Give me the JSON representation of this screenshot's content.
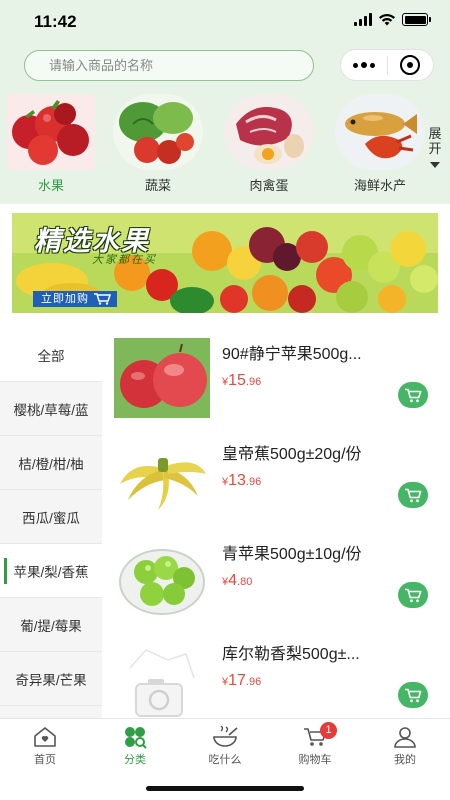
{
  "status_bar": {
    "time": "11:42"
  },
  "search": {
    "placeholder": "请输入商品的名称"
  },
  "categories": [
    {
      "label": "水果",
      "icon": "fruit-image"
    },
    {
      "label": "蔬菜",
      "icon": "vegetable-image"
    },
    {
      "label": "肉禽蛋",
      "icon": "meat-egg-image"
    },
    {
      "label": "海鲜水产",
      "icon": "seafood-image"
    }
  ],
  "expand_label": "展开",
  "banner": {
    "title": "精选水果",
    "subtitle": "大家都在买",
    "button_label": "立即加购"
  },
  "side_menu": [
    {
      "label": "全部"
    },
    {
      "label": "樱桃/草莓/蓝"
    },
    {
      "label": "桔/橙/柑/柚"
    },
    {
      "label": "西瓜/蜜瓜"
    },
    {
      "label": "苹果/梨/香蕉",
      "active": true
    },
    {
      "label": "葡/提/莓果"
    },
    {
      "label": "奇异果/芒果"
    }
  ],
  "products": [
    {
      "name": "90#静宁苹果500g...",
      "currency": "¥",
      "price_int": "15",
      "price_dec": ".96",
      "icon": "red-apple-image"
    },
    {
      "name": "皇帝蕉500g±20g/份",
      "currency": "¥",
      "price_int": "13",
      "price_dec": ".96",
      "icon": "banana-image"
    },
    {
      "name": "青苹果500g±10g/份",
      "currency": "¥",
      "price_int": "4",
      "price_dec": ".80",
      "icon": "green-apple-image"
    },
    {
      "name": "库尔勒香梨500g±...",
      "currency": "¥",
      "price_int": "17",
      "price_dec": ".96",
      "icon": "image-placeholder-icon"
    }
  ],
  "tabs": [
    {
      "label": "首页",
      "icon": "home-icon"
    },
    {
      "label": "分类",
      "icon": "clover-icon",
      "active": true
    },
    {
      "label": "吃什么",
      "icon": "bowl-icon"
    },
    {
      "label": "购物车",
      "icon": "cart-icon",
      "badge": "1"
    },
    {
      "label": "我的",
      "icon": "user-icon"
    }
  ],
  "colors": {
    "accent_green": "#2f9e44",
    "header_bg": "#e6f3e6",
    "price_red": "#e8483b",
    "cart_button": "#45b566",
    "badge_red": "#e63b3b"
  }
}
